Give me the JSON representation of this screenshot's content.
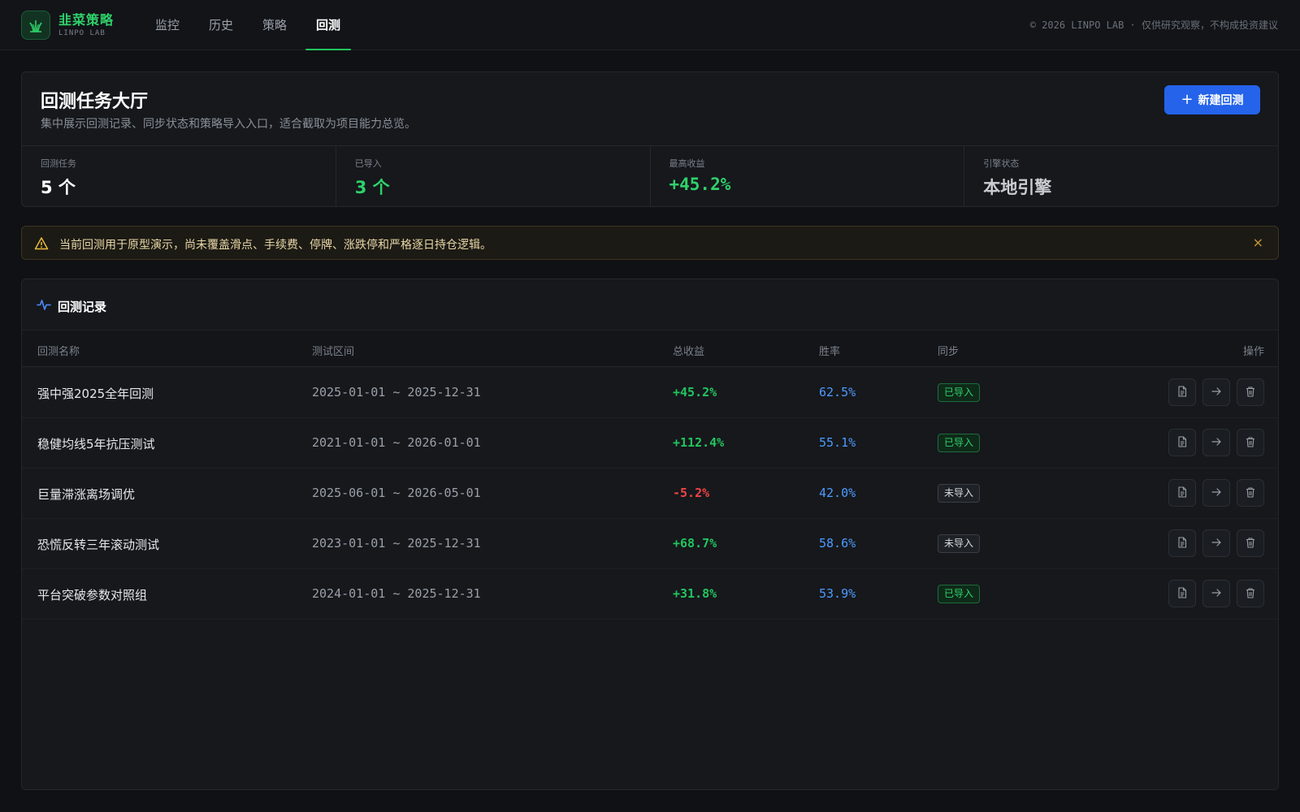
{
  "brand": {
    "name": "韭菜策略",
    "sub": "LINPO LAB"
  },
  "nav": [
    {
      "label": "监控",
      "active": false
    },
    {
      "label": "历史",
      "active": false
    },
    {
      "label": "策略",
      "active": false
    },
    {
      "label": "回测",
      "active": true
    }
  ],
  "copyright": "© 2026 LINPO LAB · 仅供研究观察，不构成投资建议",
  "hero": {
    "title": "回测任务大厅",
    "subtitle": "集中展示回测记录、同步状态和策略导入入口，适合截取为项目能力总览。",
    "new_button": "新建回测",
    "stats": [
      {
        "label": "回测任务",
        "value": "5 个"
      },
      {
        "label": "已导入",
        "value": "3 个"
      },
      {
        "label": "最高收益",
        "value": "+45.2%"
      },
      {
        "label": "引擎状态",
        "value": "本地引擎"
      }
    ]
  },
  "warning": {
    "text": "当前回测用于原型演示，尚未覆盖滑点、手续费、停牌、涨跌停和严格逐日持仓逻辑。",
    "close": "×"
  },
  "records": {
    "title": "回测记录",
    "columns": {
      "name": "回测名称",
      "range": "测试区间",
      "ret": "总收益",
      "win": "胜率",
      "sync": "同步",
      "ops": "操作"
    },
    "rows": [
      {
        "name": "强中强2025全年回测",
        "range": "2025-01-01 ~ 2025-12-31",
        "ret": "+45.2%",
        "win": "62.5%",
        "sync": "已导入"
      },
      {
        "name": "稳健均线5年抗压测试",
        "range": "2021-01-01 ~ 2026-01-01",
        "ret": "+112.4%",
        "win": "55.1%",
        "sync": "已导入"
      },
      {
        "name": "巨量滞涨离场调优",
        "range": "2025-06-01 ~ 2026-05-01",
        "ret": "-5.2%",
        "win": "42.0%",
        "sync": "未导入"
      },
      {
        "name": "恐慌反转三年滚动测试",
        "range": "2023-01-01 ~ 2025-12-31",
        "ret": "+68.7%",
        "win": "58.6%",
        "sync": "未导入"
      },
      {
        "name": "平台突破参数对照组",
        "range": "2024-01-01 ~ 2025-12-31",
        "ret": "+31.8%",
        "win": "53.9%",
        "sync": "已导入"
      }
    ]
  },
  "icons": {
    "logo": "sprout-icon",
    "warning": "warning-triangle-icon",
    "records": "activity-pulse-icon",
    "report": "document-icon",
    "open": "arrow-right-icon",
    "delete": "trash-icon"
  },
  "colors": {
    "accent_green": "#22c55e",
    "accent_blue": "#2563eb",
    "negative_red": "#ef4444",
    "winrate_blue": "#4d9bff",
    "warning_amber": "#e8b93a"
  }
}
